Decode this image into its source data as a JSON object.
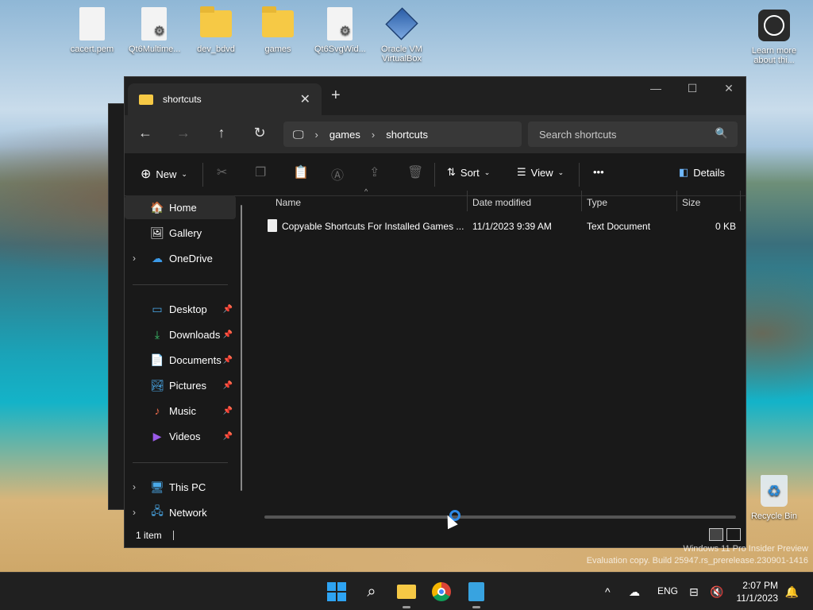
{
  "desktop": {
    "icons": [
      {
        "label": "cacert.pem",
        "icon": "document-icon"
      },
      {
        "label": "Qt6Multime...",
        "icon": "settings-document-icon"
      },
      {
        "label": "dev_bdvd",
        "icon": "folder-icon"
      },
      {
        "label": "games",
        "icon": "folder-icon"
      },
      {
        "label": "Qt6SvgWid...",
        "icon": "settings-document-icon"
      },
      {
        "label": "Oracle VM VirtualBox",
        "icon": "virtualbox-icon"
      },
      {
        "label": "Learn more about thi...",
        "icon": "learn-more-icon"
      },
      {
        "label": "Recycle Bin",
        "icon": "recycle-bin-icon"
      }
    ]
  },
  "explorer": {
    "tab_title": "shortcuts",
    "address": {
      "segments": [
        "games",
        "shortcuts"
      ]
    },
    "search_placeholder": "Search shortcuts",
    "toolbar": {
      "new": "New",
      "sort": "Sort",
      "view": "View",
      "more": "•••",
      "details": "Details"
    },
    "nav": {
      "items": [
        {
          "label": "Home"
        },
        {
          "label": "Gallery"
        },
        {
          "label": "OneDrive"
        },
        {
          "label": "Desktop"
        },
        {
          "label": "Downloads"
        },
        {
          "label": "Documents"
        },
        {
          "label": "Pictures"
        },
        {
          "label": "Music"
        },
        {
          "label": "Videos"
        },
        {
          "label": "This PC"
        },
        {
          "label": "Network"
        }
      ]
    },
    "columns": {
      "name": "Name",
      "date": "Date modified",
      "type": "Type",
      "size": "Size"
    },
    "files": [
      {
        "name": "Copyable Shortcuts For Installed Games ...",
        "date": "11/1/2023 9:39 AM",
        "type": "Text Document",
        "size": "0 KB"
      }
    ],
    "status": "1 item"
  },
  "taskbar": {
    "lang": "ENG",
    "time": "2:07 PM",
    "date": "11/1/2023"
  },
  "watermark": {
    "line1": "Windows 11 Pro Insider Preview",
    "line2": "Evaluation copy. Build 25947.rs_prerelease.230901-1416"
  }
}
